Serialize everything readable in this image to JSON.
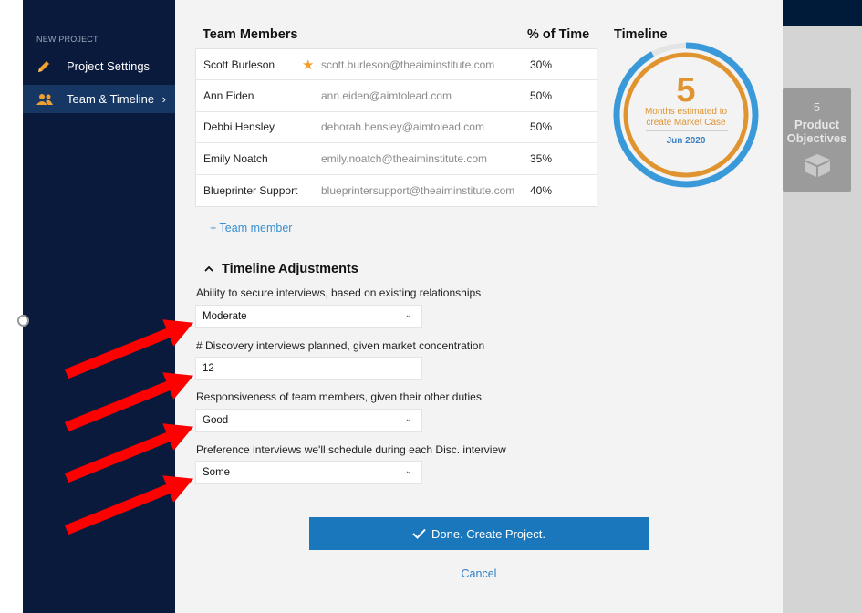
{
  "sidebar": {
    "section_label": "NEW PROJECT",
    "items": [
      {
        "label": "Project Settings",
        "icon": "pencil-icon",
        "active": false
      },
      {
        "label": "Team & Timeline",
        "icon": "team-icon",
        "active": true,
        "chevron": "›"
      }
    ]
  },
  "team": {
    "header": "Team Members",
    "pct_header": "% of Time",
    "members": [
      {
        "name": "Scott Burleson",
        "email": "scott.burleson@theaiminstitute.com",
        "pct": "30%",
        "starred": true
      },
      {
        "name": "Ann Eiden",
        "email": "ann.eiden@aimtolead.com",
        "pct": "50%",
        "starred": false
      },
      {
        "name": "Debbi Hensley",
        "email": "deborah.hensley@aimtolead.com",
        "pct": "50%",
        "starred": false
      },
      {
        "name": "Emily Noatch",
        "email": "emily.noatch@theaiminstitute.com",
        "pct": "35%",
        "starred": false
      },
      {
        "name": "Blueprinter Support",
        "email": "blueprintersupport@theaiminstitute.com",
        "pct": "40%",
        "starred": false
      }
    ],
    "add_label": "+ Team member"
  },
  "timeline": {
    "header": "Timeline",
    "months": "5",
    "caption": "Months estimated to create Market Case",
    "date": "Jun 2020",
    "progress": 0.92,
    "colors": {
      "outer": "#3a9ad9",
      "inner": "#e09430",
      "track": "#e4e4e4"
    }
  },
  "adjustments": {
    "header": "Timeline Adjustments",
    "caret": "^",
    "fields": [
      {
        "label": "Ability to secure interviews, based on existing relationships",
        "value": "Moderate",
        "type": "select"
      },
      {
        "label": "# Discovery interviews planned, given market concentration",
        "value": "12",
        "type": "input"
      },
      {
        "label": "Responsiveness of team members, given their other duties",
        "value": "Good",
        "type": "select"
      },
      {
        "label": "Preference interviews we'll schedule during each Disc. interview",
        "value": "Some",
        "type": "select"
      }
    ]
  },
  "actions": {
    "done_label": "Done. Create Project.",
    "cancel_label": "Cancel"
  },
  "background": {
    "card_number": "5",
    "card_label_1": "Product",
    "card_label_2": "Objectives"
  },
  "colors": {
    "sidebar": "#0a1a3c",
    "sidebar_active": "#163664",
    "primary": "#1b77bb",
    "accent_orange": "#e09430",
    "annotation_red": "#ff0000"
  }
}
